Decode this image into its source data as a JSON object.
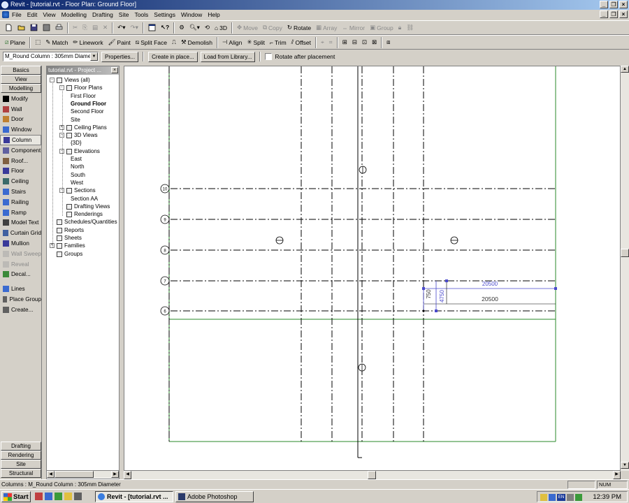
{
  "window": {
    "title": "Revit - [tutorial.rvt - Floor Plan: Ground Floor]"
  },
  "menu": [
    "File",
    "Edit",
    "View",
    "Modelling",
    "Drafting",
    "Site",
    "Tools",
    "Settings",
    "Window",
    "Help"
  ],
  "toolbar1": {
    "three_d": "3D",
    "move": "Move",
    "copy": "Copy",
    "rotate": "Rotate",
    "array": "Array",
    "mirror": "Mirror",
    "group": "Group"
  },
  "toolbar2": {
    "plane": "Plane",
    "match": "Match",
    "linework": "Linework",
    "paint": "Paint",
    "split_face": "Split Face",
    "demolish": "Demolish",
    "align": "Align",
    "split": "Split",
    "trim": "Trim",
    "offset": "Offset"
  },
  "options": {
    "type_selector": "M_Round Column : 305mm Diameter",
    "properties": "Properties...",
    "create_in_place": "Create in place...",
    "load_from_library": "Load from Library...",
    "rotate_after_placement": "Rotate after placement"
  },
  "design_bar": {
    "top_tabs": [
      "Basics",
      "View",
      "Modelling"
    ],
    "tools": [
      {
        "label": "Modify",
        "icon": "arrow-icon",
        "selected": false,
        "disabled": false
      },
      {
        "label": "Wall",
        "icon": "wall-icon",
        "selected": false,
        "disabled": false
      },
      {
        "label": "Door",
        "icon": "door-icon",
        "selected": false,
        "disabled": false
      },
      {
        "label": "Window",
        "icon": "window-icon",
        "selected": false,
        "disabled": false
      },
      {
        "label": "Column",
        "icon": "column-icon",
        "selected": true,
        "disabled": false
      },
      {
        "label": "Component",
        "icon": "component-icon",
        "selected": false,
        "disabled": false
      },
      {
        "label": "Roof...",
        "icon": "roof-icon",
        "selected": false,
        "disabled": false
      },
      {
        "label": "Floor",
        "icon": "floor-icon",
        "selected": false,
        "disabled": false
      },
      {
        "label": "Ceiling",
        "icon": "ceiling-icon",
        "selected": false,
        "disabled": false
      },
      {
        "label": "Stairs",
        "icon": "stairs-icon",
        "selected": false,
        "disabled": false
      },
      {
        "label": "Railing",
        "icon": "railing-icon",
        "selected": false,
        "disabled": false
      },
      {
        "label": "Ramp",
        "icon": "ramp-icon",
        "selected": false,
        "disabled": false
      },
      {
        "label": "Model Text",
        "icon": "text-icon",
        "selected": false,
        "disabled": false
      },
      {
        "label": "Curtain Grid",
        "icon": "curtain-grid-icon",
        "selected": false,
        "disabled": false
      },
      {
        "label": "Mullion",
        "icon": "mullion-icon",
        "selected": false,
        "disabled": false
      },
      {
        "label": "Wall Sweep",
        "icon": "wall-sweep-icon",
        "selected": false,
        "disabled": true
      },
      {
        "label": "Reveal",
        "icon": "reveal-icon",
        "selected": false,
        "disabled": true
      },
      {
        "label": "Decal...",
        "icon": "decal-icon",
        "selected": false,
        "disabled": false
      },
      {
        "label": "Lines",
        "icon": "lines-icon",
        "selected": false,
        "disabled": false
      },
      {
        "label": "Place Group",
        "icon": "group-icon",
        "selected": false,
        "disabled": false
      },
      {
        "label": "Create...",
        "icon": "create-icon",
        "selected": false,
        "disabled": false
      }
    ],
    "bottom_tabs": [
      "Drafting",
      "Rendering",
      "Site",
      "Structural"
    ]
  },
  "browser": {
    "title": "tutorial.rvt - Project ...",
    "tree": [
      {
        "label": "Views (all)",
        "level": 0,
        "pm": "-",
        "bold": false
      },
      {
        "label": "Floor Plans",
        "level": 1,
        "pm": "-",
        "bold": false
      },
      {
        "label": "First Floor",
        "level": 2,
        "pm": "",
        "bold": false
      },
      {
        "label": "Ground Floor",
        "level": 2,
        "pm": "",
        "bold": true
      },
      {
        "label": "Second Floor",
        "level": 2,
        "pm": "",
        "bold": false
      },
      {
        "label": "Site",
        "level": 2,
        "pm": "",
        "bold": false
      },
      {
        "label": "Ceiling Plans",
        "level": 1,
        "pm": "+",
        "bold": false
      },
      {
        "label": "3D Views",
        "level": 1,
        "pm": "-",
        "bold": false
      },
      {
        "label": "{3D}",
        "level": 2,
        "pm": "",
        "bold": false
      },
      {
        "label": "Elevations",
        "level": 1,
        "pm": "-",
        "bold": false
      },
      {
        "label": "East",
        "level": 2,
        "pm": "",
        "bold": false
      },
      {
        "label": "North",
        "level": 2,
        "pm": "",
        "bold": false
      },
      {
        "label": "South",
        "level": 2,
        "pm": "",
        "bold": false
      },
      {
        "label": "West",
        "level": 2,
        "pm": "",
        "bold": false
      },
      {
        "label": "Sections",
        "level": 1,
        "pm": "-",
        "bold": false
      },
      {
        "label": "Section AA",
        "level": 2,
        "pm": "",
        "bold": false
      },
      {
        "label": "Drafting Views",
        "level": 1,
        "pm": "",
        "bold": false
      },
      {
        "label": "Renderings",
        "level": 1,
        "pm": "",
        "bold": false
      },
      {
        "label": "Schedules/Quantities",
        "level": 0,
        "pm": "",
        "bold": false
      },
      {
        "label": "Reports",
        "level": 0,
        "pm": "",
        "bold": false
      },
      {
        "label": "Sheets",
        "level": 0,
        "pm": "",
        "bold": false
      },
      {
        "label": "Families",
        "level": 0,
        "pm": "+",
        "bold": false
      },
      {
        "label": "Groups",
        "level": 0,
        "pm": "",
        "bold": false
      }
    ]
  },
  "drawing": {
    "grid_bubbles": [
      "10",
      "9",
      "8",
      "7",
      "6"
    ],
    "dim_top": "20500",
    "dim_main": "20500",
    "dim_vertical": "4750",
    "dim_small": "750"
  },
  "status": {
    "text": "Columns : M_Round Column : 305mm Diameter",
    "num": "NUM"
  },
  "taskbar": {
    "start": "Start",
    "tasks": [
      {
        "label": "Revit - [tutorial.rvt ...",
        "active": true
      },
      {
        "label": "Adobe Photoshop",
        "active": false
      }
    ],
    "lang": "EN",
    "clock": "12:39 PM"
  }
}
